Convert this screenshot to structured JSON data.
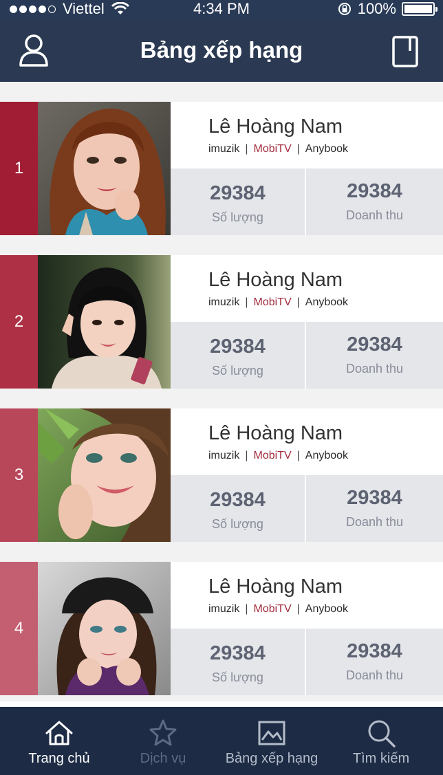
{
  "status_bar": {
    "carrier": "Viettel",
    "time": "4:34 PM",
    "battery": "100%"
  },
  "header": {
    "title": "Bảng xếp hạng"
  },
  "colors": {
    "header_bg": "#2b3a52",
    "tabbar_bg": "#1d2b45",
    "rank_1": "#a11d33",
    "rank_2": "#ad3045",
    "rank_3": "#b9475a",
    "rank_4": "#c35f70",
    "stat_bg": "#e4e6ea",
    "source_highlight": "#a22a3c"
  },
  "rankings": [
    {
      "rank": "1",
      "name": "Lê Hoàng Nam",
      "sources": [
        "imuzik",
        "MobiTV",
        "Anybook"
      ],
      "quantity": "29384",
      "quantity_label": "Số lượng",
      "revenue": "29384",
      "revenue_label": "Doanh thu"
    },
    {
      "rank": "2",
      "name": "Lê Hoàng Nam",
      "sources": [
        "imuzik",
        "MobiTV",
        "Anybook"
      ],
      "quantity": "29384",
      "quantity_label": "Số lượng",
      "revenue": "29384",
      "revenue_label": "Doanh thu"
    },
    {
      "rank": "3",
      "name": "Lê Hoàng Nam",
      "sources": [
        "imuzik",
        "MobiTV",
        "Anybook"
      ],
      "quantity": "29384",
      "quantity_label": "Số lượng",
      "revenue": "29384",
      "revenue_label": "Doanh thu"
    },
    {
      "rank": "4",
      "name": "Lê Hoàng Nam",
      "sources": [
        "imuzik",
        "MobiTV",
        "Anybook"
      ],
      "quantity": "29384",
      "quantity_label": "Số lượng",
      "revenue": "29384",
      "revenue_label": "Doanh thu"
    }
  ],
  "tabs": [
    {
      "label": "Trang chủ",
      "icon": "home-icon"
    },
    {
      "label": "Dịch vụ",
      "icon": "star-icon"
    },
    {
      "label": "Bảng xếp hạng",
      "icon": "image-icon"
    },
    {
      "label": "Tìm kiếm",
      "icon": "search-icon"
    }
  ],
  "separator": "|"
}
